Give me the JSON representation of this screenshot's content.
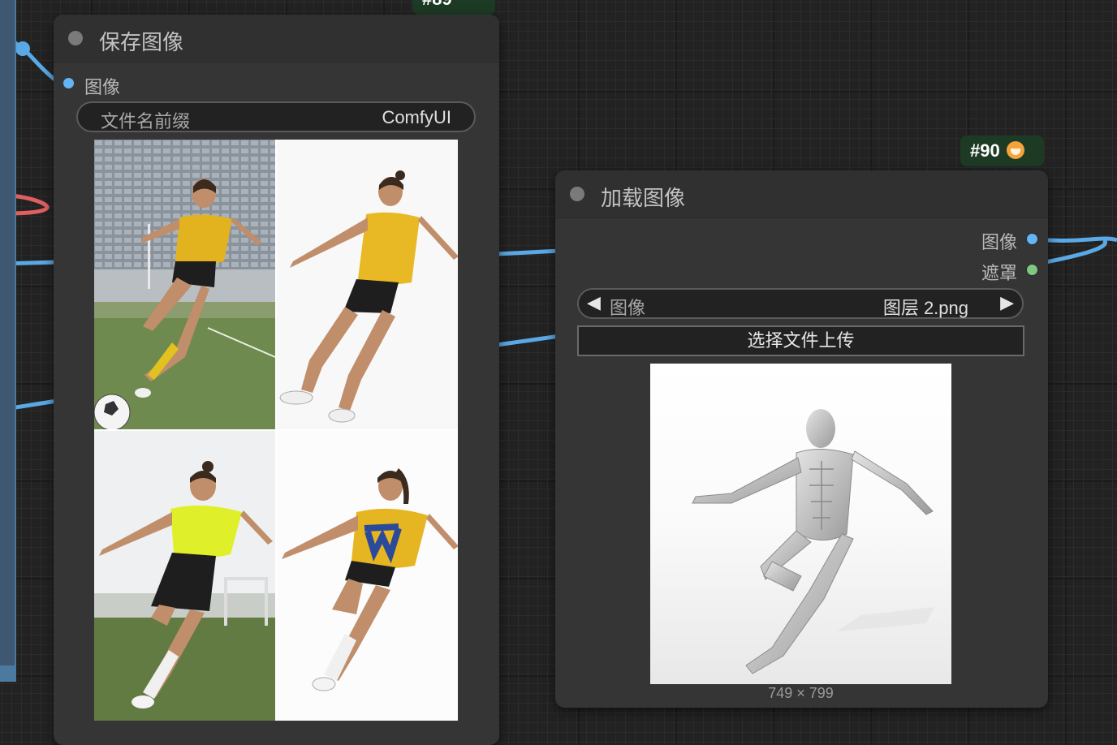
{
  "canvas": {
    "partial_badge_top": "#89"
  },
  "save_node": {
    "title": "保存图像",
    "input_label": "图像",
    "widget_label": "文件名前缀",
    "widget_value": "ComfyUI",
    "image_grid": [
      {
        "alt": "Soccer player in yellow jersey kicking ball on stadium pitch"
      },
      {
        "alt": "Soccer player in yellow jersey on white background"
      },
      {
        "alt": "Soccer player in lime jersey on grass field"
      },
      {
        "alt": "Soccer player in yellow jersey with blue logo on white background"
      }
    ]
  },
  "load_node": {
    "badge": "#90",
    "title": "加载图像",
    "outputs": [
      {
        "label": "图像",
        "color": "#64b5f6"
      },
      {
        "label": "遮罩",
        "color": "#81c784"
      }
    ],
    "combo_label": "图像",
    "combo_value": "图层 2.png",
    "upload_button": "选择文件上传",
    "preview_caption": "749 × 799",
    "preview_alt": "Grey anatomical muscle figure in kicking pose"
  },
  "colors": {
    "wire_blue": "#5aa9e6",
    "wire_red": "#e06060",
    "badge_bg": "#1d3b24",
    "node_bg": "#353535"
  }
}
